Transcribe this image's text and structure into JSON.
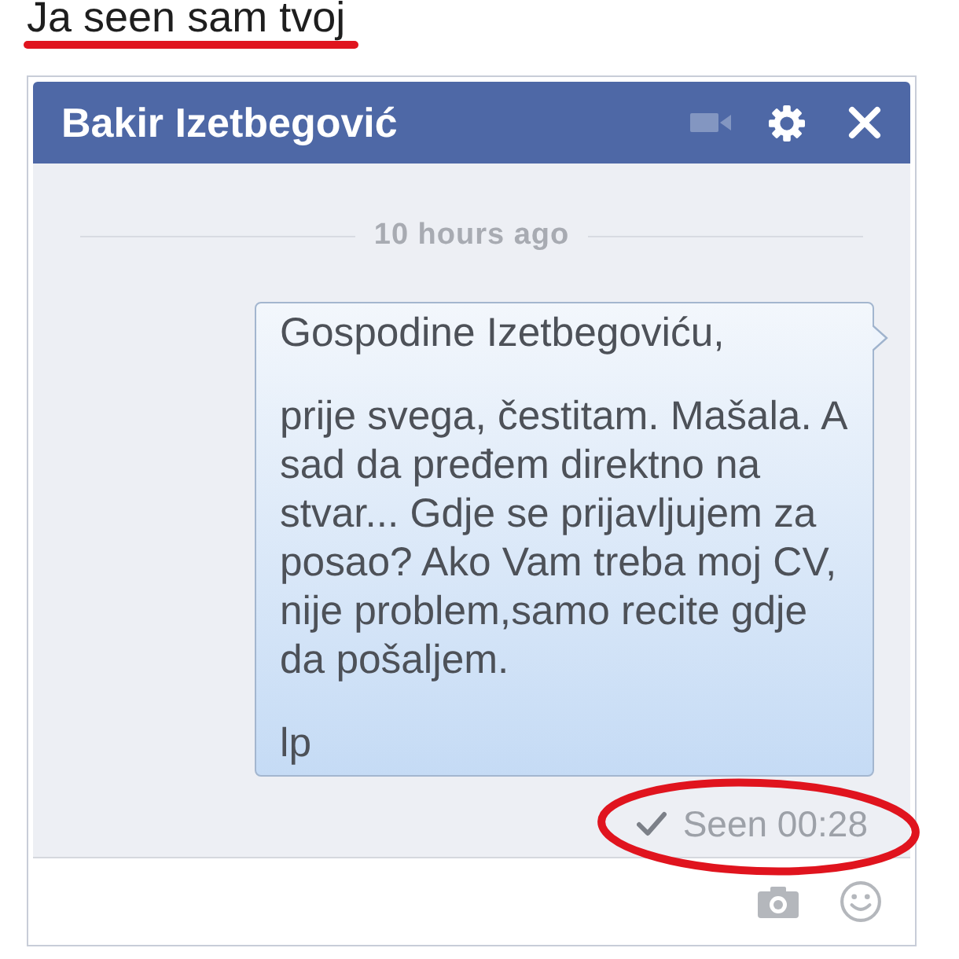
{
  "caption": {
    "text": "Ja seen sam tvoj",
    "underlined": true
  },
  "chat_window": {
    "title": "Bakir Izetbegović",
    "header_actions": [
      {
        "kind": "video",
        "disabled": true
      },
      {
        "kind": "settings",
        "disabled": false
      },
      {
        "kind": "close",
        "disabled": false
      }
    ],
    "timestamp": "10 hours ago",
    "message": {
      "paragraphs": [
        "Gospodine Izetbegoviću,",
        "prije svega, čestitam. Mašala. A sad da pređem direktno na stvar... Gdje se prijavljujem za posao? Ako Vam treba moj CV, nije problem,samo recite gdje da pošaljem.",
        "lp"
      ]
    },
    "receipt": {
      "text": "Seen 00:28",
      "circled": true
    },
    "compose_actions": [
      {
        "kind": "photo"
      },
      {
        "kind": "emoji"
      }
    ]
  }
}
